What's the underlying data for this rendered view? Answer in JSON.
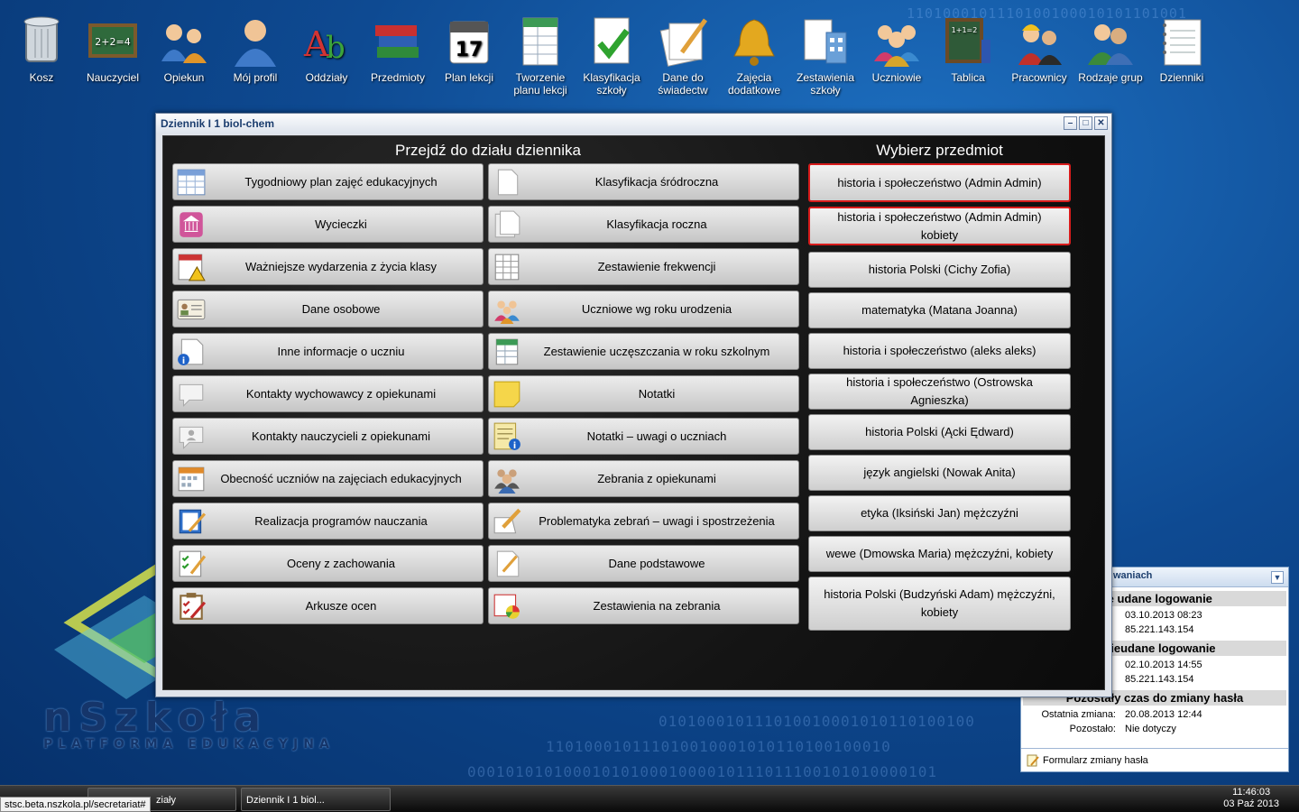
{
  "desktop": {
    "icons": [
      {
        "label": "Kosz",
        "icon": "trash-icon"
      },
      {
        "label": "Nauczyciel",
        "icon": "chalkboard-icon"
      },
      {
        "label": "Opiekun",
        "icon": "parents-icon"
      },
      {
        "label": "Mój profil",
        "icon": "user-profile-icon"
      },
      {
        "label": "Oddziały",
        "icon": "letters-icon"
      },
      {
        "label": "Przedmioty",
        "icon": "books-icon"
      },
      {
        "label": "Plan lekcji",
        "icon": "calendar-icon"
      },
      {
        "label": "Tworzenie planu lekcji",
        "icon": "spreadsheet-icon"
      },
      {
        "label": "Klasyfikacja szkoły",
        "icon": "checkmark-icon"
      },
      {
        "label": "Dane do świadectw",
        "icon": "documents-pen-icon"
      },
      {
        "label": "Zajęcia dodatkowe",
        "icon": "bell-icon"
      },
      {
        "label": "Zestawienia szkoły",
        "icon": "building-report-icon"
      },
      {
        "label": "Uczniowie",
        "icon": "students-icon"
      },
      {
        "label": "Tablica",
        "icon": "blackboard-icon"
      },
      {
        "label": "Pracownicy",
        "icon": "workers-icon"
      },
      {
        "label": "Rodzaje grup",
        "icon": "group-icon"
      },
      {
        "label": "Dzienniki",
        "icon": "journal-icon"
      }
    ],
    "logo_main": "nSzkoła",
    "logo_sub": "PLATFORMA EDUKACYJNA",
    "binary_lines": [
      "1101000101110100100010101101001",
      "010100010111010010001010110100100",
      "110100010111010010001010110100100010",
      "0001010101000101010001000010111011100101010000101"
    ]
  },
  "window": {
    "title": "Dziennik I 1 biol-chem",
    "left_heading": "Przejdź do działu dziennika",
    "right_heading": "Wybierz przedmiot",
    "col1": [
      {
        "label": "Tygodniowy plan zajęć edukacyjnych",
        "icon": "calendar-grid-icon"
      },
      {
        "label": "Wycieczki",
        "icon": "museum-icon"
      },
      {
        "label": "Ważniejsze wydarzenia z życia klasy",
        "icon": "calendar-warning-icon"
      },
      {
        "label": "Dane osobowe",
        "icon": "id-card-icon"
      },
      {
        "label": "Inne informacje o uczniu",
        "icon": "document-info-icon"
      },
      {
        "label": "Kontakty wychowawcy z opiekunami",
        "icon": "speech-bubble-icon"
      },
      {
        "label": "Kontakty nauczycieli z opiekunami",
        "icon": "contact-bubble-icon"
      },
      {
        "label": "Obecność uczniów na zajęciach edukacyjnych",
        "icon": "attendance-calendar-icon"
      },
      {
        "label": "Realizacja programów nauczania",
        "icon": "notebook-pen-icon"
      },
      {
        "label": "Oceny z zachowania",
        "icon": "checklist-icon"
      },
      {
        "label": "Arkusze ocen",
        "icon": "clipboard-icon"
      }
    ],
    "col2": [
      {
        "label": "Klasyfikacja śródroczna",
        "icon": "page-icon"
      },
      {
        "label": "Klasyfikacja roczna",
        "icon": "pages-icon"
      },
      {
        "label": "Zestawienie frekwencji",
        "icon": "table-icon"
      },
      {
        "label": "Uczniowe wg roku urodzenia",
        "icon": "people-icon"
      },
      {
        "label": "Zestawienie uczęszczania w roku szkolnym",
        "icon": "sheet-icon"
      },
      {
        "label": "Notatki",
        "icon": "sticky-note-icon"
      },
      {
        "label": "Notatki – uwagi o uczniach",
        "icon": "note-info-icon"
      },
      {
        "label": "Zebrania z opiekunami",
        "icon": "meeting-icon"
      },
      {
        "label": "Problematyka zebrań – uwagi i spostrzeżenia",
        "icon": "pencil-paper-icon"
      },
      {
        "label": "Dane podstawowe",
        "icon": "edit-document-icon"
      },
      {
        "label": "Zestawienia na zebrania",
        "icon": "report-chart-icon"
      }
    ],
    "subjects": [
      {
        "label": "historia i społeczeństwo (Admin Admin)",
        "selected": true
      },
      {
        "label": "historia i społeczeństwo (Admin Admin) kobiety",
        "selected": true
      },
      {
        "label": "historia Polski (Cichy Zofia)",
        "selected": false
      },
      {
        "label": "matematyka (Matana Joanna)",
        "selected": false
      },
      {
        "label": "historia i społeczeństwo (aleks aleks)",
        "selected": false
      },
      {
        "label": "historia i społeczeństwo (Ostrowska Agnieszka)",
        "selected": false
      },
      {
        "label": "historia Polski (Ącki Ędward)",
        "selected": false
      },
      {
        "label": "język angielski (Nowak Anita)",
        "selected": false
      },
      {
        "label": "etyka (Iksiński Jan) mężczyźni",
        "selected": false
      },
      {
        "label": "wewe (Dmowska Maria) mężczyźni, kobiety",
        "selected": false
      },
      {
        "label": "historia Polski (Budzyński Adam) mężczyźni, kobiety",
        "selected": false
      }
    ]
  },
  "login_panel": {
    "header": "waniach",
    "sec1": "nie udane logowanie",
    "s1_date": "03.10.2013 08:23",
    "s1_ip": "85.221.143.154",
    "sec2": "e nieudane logowanie",
    "s2_date": "02.10.2013 14:55",
    "s2_ip": "85.221.143.154",
    "sec3": "Pozostały czas do zmiany hasła",
    "last_change_label": "Ostatnia zmiana:",
    "last_change_value": "20.08.2013 12:44",
    "remaining_label": "Pozostało:",
    "remaining_value": "Nie dotyczy",
    "footer_link": "Formularz zmiany hasła"
  },
  "taskbar": {
    "task1": "ziały",
    "task2": "Dziennik I 1 biol...",
    "time": "11:46:03",
    "date": "03 Paź 2013",
    "status_url": "stsc.beta.nszkola.pl/secretariat#"
  }
}
